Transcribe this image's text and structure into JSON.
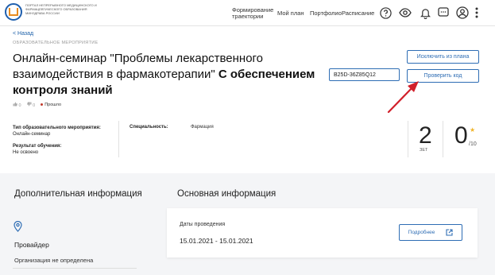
{
  "header": {
    "logo_text": "Портал непрерывного медицинского и фармацевтического образования Минздрава России",
    "nav": [
      {
        "label": "Формирование траектории"
      },
      {
        "label": "Мой план"
      },
      {
        "label": "Портфолио"
      },
      {
        "label": "Расписание"
      }
    ],
    "icons": [
      "help-icon",
      "eye-icon",
      "bell-icon",
      "chat-icon",
      "user-avatar-icon",
      "more-vertical-icon"
    ]
  },
  "page": {
    "back_label": "< Назад",
    "kind_label": "ОБРАЗОВАТЕЛЬНОЕ МЕРОПРИЯТИЕ",
    "title_regular": "Онлайн-семинар \"Проблемы лекарственного взаимодействия в фармакотерапии\" ",
    "title_bold": "С обеспечением контроля знаний",
    "meta": {
      "likes": "0",
      "dislikes": "0",
      "status": "Прошло"
    },
    "code_value": "B25D-36Z85Q12",
    "exclude_button": "Исключить из плана",
    "check_button": "Проверить код"
  },
  "info": {
    "type_label": "Тип образовательного мероприятия:",
    "type_value": "Онлайн-семинар",
    "result_label": "Результат обучения:",
    "result_value": "Не освоено",
    "spec_label": "Специальность:",
    "spec_value": "Фармация",
    "zet_value": "2",
    "zet_label": "ЗЕТ",
    "score_value": "0",
    "score_max": "/10"
  },
  "additional": {
    "heading": "Дополнительная информация",
    "provider_label": "Провайдер",
    "provider_value": "Организация не определена"
  },
  "main_info": {
    "heading": "Основная информация",
    "dates_label": "Даты проведения",
    "dates_value": "15.01.2021 - 15.01.2021",
    "more_button": "Подробнее"
  },
  "colors": {
    "accent": "#2e6db4",
    "annotation_arrow": "#d11f2a",
    "star": "#f0b429",
    "bottom_bg": "#f4f5f7"
  }
}
